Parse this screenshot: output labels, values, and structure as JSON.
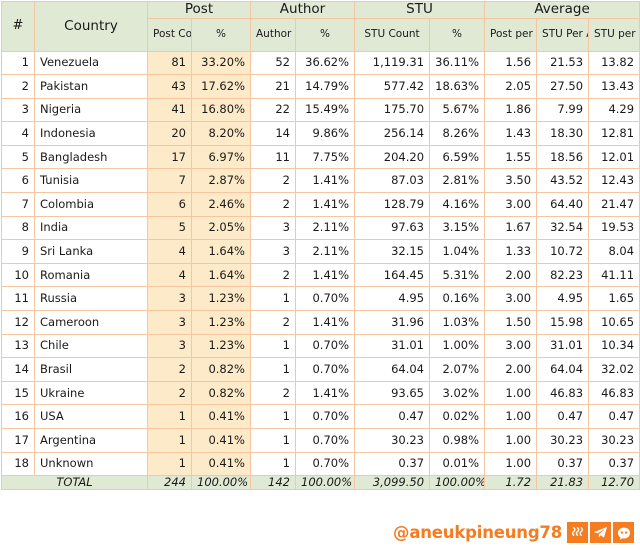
{
  "table": {
    "header": {
      "col_hash": "#",
      "col_country": "Country",
      "groups": [
        {
          "label": "Post",
          "subs": [
            "Post Count",
            "%"
          ]
        },
        {
          "label": "Author",
          "subs": [
            "Author Count",
            "%"
          ]
        },
        {
          "label": "STU",
          "subs": [
            "STU Count",
            "%"
          ]
        },
        {
          "label": "Average",
          "subs": [
            "Post per Author",
            "STU Per Author",
            "STU per Post"
          ]
        }
      ]
    },
    "rows": [
      {
        "n": "1",
        "country": "Venezuela",
        "post_count": "81",
        "post_pct": "33.20%",
        "author_count": "52",
        "author_pct": "36.62%",
        "stu_count": "1,119.31",
        "stu_pct": "36.11%",
        "post_per_author": "1.56",
        "stu_per_author": "21.53",
        "stu_per_post": "13.82"
      },
      {
        "n": "2",
        "country": "Pakistan",
        "post_count": "43",
        "post_pct": "17.62%",
        "author_count": "21",
        "author_pct": "14.79%",
        "stu_count": "577.42",
        "stu_pct": "18.63%",
        "post_per_author": "2.05",
        "stu_per_author": "27.50",
        "stu_per_post": "13.43"
      },
      {
        "n": "3",
        "country": "Nigeria",
        "post_count": "41",
        "post_pct": "16.80%",
        "author_count": "22",
        "author_pct": "15.49%",
        "stu_count": "175.70",
        "stu_pct": "5.67%",
        "post_per_author": "1.86",
        "stu_per_author": "7.99",
        "stu_per_post": "4.29"
      },
      {
        "n": "4",
        "country": "Indonesia",
        "post_count": "20",
        "post_pct": "8.20%",
        "author_count": "14",
        "author_pct": "9.86%",
        "stu_count": "256.14",
        "stu_pct": "8.26%",
        "post_per_author": "1.43",
        "stu_per_author": "18.30",
        "stu_per_post": "12.81"
      },
      {
        "n": "5",
        "country": "Bangladesh",
        "post_count": "17",
        "post_pct": "6.97%",
        "author_count": "11",
        "author_pct": "7.75%",
        "stu_count": "204.20",
        "stu_pct": "6.59%",
        "post_per_author": "1.55",
        "stu_per_author": "18.56",
        "stu_per_post": "12.01"
      },
      {
        "n": "6",
        "country": "Tunisia",
        "post_count": "7",
        "post_pct": "2.87%",
        "author_count": "2",
        "author_pct": "1.41%",
        "stu_count": "87.03",
        "stu_pct": "2.81%",
        "post_per_author": "3.50",
        "stu_per_author": "43.52",
        "stu_per_post": "12.43"
      },
      {
        "n": "7",
        "country": "Colombia",
        "post_count": "6",
        "post_pct": "2.46%",
        "author_count": "2",
        "author_pct": "1.41%",
        "stu_count": "128.79",
        "stu_pct": "4.16%",
        "post_per_author": "3.00",
        "stu_per_author": "64.40",
        "stu_per_post": "21.47"
      },
      {
        "n": "8",
        "country": "India",
        "post_count": "5",
        "post_pct": "2.05%",
        "author_count": "3",
        "author_pct": "2.11%",
        "stu_count": "97.63",
        "stu_pct": "3.15%",
        "post_per_author": "1.67",
        "stu_per_author": "32.54",
        "stu_per_post": "19.53"
      },
      {
        "n": "9",
        "country": "Sri Lanka",
        "post_count": "4",
        "post_pct": "1.64%",
        "author_count": "3",
        "author_pct": "2.11%",
        "stu_count": "32.15",
        "stu_pct": "1.04%",
        "post_per_author": "1.33",
        "stu_per_author": "10.72",
        "stu_per_post": "8.04"
      },
      {
        "n": "10",
        "country": "Romania",
        "post_count": "4",
        "post_pct": "1.64%",
        "author_count": "2",
        "author_pct": "1.41%",
        "stu_count": "164.45",
        "stu_pct": "5.31%",
        "post_per_author": "2.00",
        "stu_per_author": "82.23",
        "stu_per_post": "41.11"
      },
      {
        "n": "11",
        "country": "Russia",
        "post_count": "3",
        "post_pct": "1.23%",
        "author_count": "1",
        "author_pct": "0.70%",
        "stu_count": "4.95",
        "stu_pct": "0.16%",
        "post_per_author": "3.00",
        "stu_per_author": "4.95",
        "stu_per_post": "1.65"
      },
      {
        "n": "12",
        "country": "Cameroon",
        "post_count": "3",
        "post_pct": "1.23%",
        "author_count": "2",
        "author_pct": "1.41%",
        "stu_count": "31.96",
        "stu_pct": "1.03%",
        "post_per_author": "1.50",
        "stu_per_author": "15.98",
        "stu_per_post": "10.65"
      },
      {
        "n": "13",
        "country": "Chile",
        "post_count": "3",
        "post_pct": "1.23%",
        "author_count": "1",
        "author_pct": "0.70%",
        "stu_count": "31.01",
        "stu_pct": "1.00%",
        "post_per_author": "3.00",
        "stu_per_author": "31.01",
        "stu_per_post": "10.34"
      },
      {
        "n": "14",
        "country": "Brasil",
        "post_count": "2",
        "post_pct": "0.82%",
        "author_count": "1",
        "author_pct": "0.70%",
        "stu_count": "64.04",
        "stu_pct": "2.07%",
        "post_per_author": "2.00",
        "stu_per_author": "64.04",
        "stu_per_post": "32.02"
      },
      {
        "n": "15",
        "country": "Ukraine",
        "post_count": "2",
        "post_pct": "0.82%",
        "author_count": "2",
        "author_pct": "1.41%",
        "stu_count": "93.65",
        "stu_pct": "3.02%",
        "post_per_author": "1.00",
        "stu_per_author": "46.83",
        "stu_per_post": "46.83"
      },
      {
        "n": "16",
        "country": "USA",
        "post_count": "1",
        "post_pct": "0.41%",
        "author_count": "1",
        "author_pct": "0.70%",
        "stu_count": "0.47",
        "stu_pct": "0.02%",
        "post_per_author": "1.00",
        "stu_per_author": "0.47",
        "stu_per_post": "0.47"
      },
      {
        "n": "17",
        "country": "Argentina",
        "post_count": "1",
        "post_pct": "0.41%",
        "author_count": "1",
        "author_pct": "0.70%",
        "stu_count": "30.23",
        "stu_pct": "0.98%",
        "post_per_author": "1.00",
        "stu_per_author": "30.23",
        "stu_per_post": "30.23"
      },
      {
        "n": "18",
        "country": "Unknown",
        "post_count": "1",
        "post_pct": "0.41%",
        "author_count": "1",
        "author_pct": "0.70%",
        "stu_count": "0.37",
        "stu_pct": "0.01%",
        "post_per_author": "1.00",
        "stu_per_author": "0.37",
        "stu_per_post": "0.37"
      }
    ],
    "total": {
      "label": "TOTAL",
      "post_count": "244",
      "post_pct": "100.00%",
      "author_count": "142",
      "author_pct": "100.00%",
      "stu_count": "3,099.50",
      "stu_pct": "100.00%",
      "post_per_author": "1.72",
      "stu_per_author": "21.83",
      "stu_per_post": "12.70"
    }
  },
  "footer": {
    "handle": "@aneukpineung78",
    "icons": [
      "steem-icon",
      "telegram-icon",
      "discord-icon"
    ]
  },
  "colors": {
    "header_green": "#dfe9d3",
    "cell_cream": "#fdeac8",
    "border_orange": "#f5c6a0",
    "accent_orange": "#f57c20"
  }
}
